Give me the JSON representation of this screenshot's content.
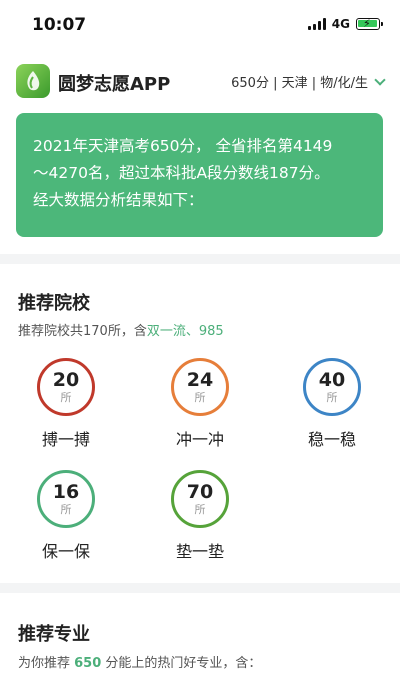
{
  "status": {
    "time": "10:07",
    "network": "4G"
  },
  "header": {
    "app_name": "圆梦志愿APP",
    "profile": "650分 | 天津 | 物/化/生"
  },
  "banner": {
    "line1": "2021年天津高考650分， 全省排名第4149",
    "line2": "～4270名，超过本科批A段分数线187分。",
    "line3": "经大数据分析结果如下："
  },
  "recommend_schools": {
    "title": "推荐院校",
    "subtitle_prefix": "推荐院校共170所，含",
    "subtitle_highlight": "双一流、985",
    "categories": [
      {
        "count": "20",
        "unit": "所",
        "label": "搏一搏",
        "color": "#c0392b"
      },
      {
        "count": "24",
        "unit": "所",
        "label": "冲一冲",
        "color": "#e67e3a"
      },
      {
        "count": "40",
        "unit": "所",
        "label": "稳一稳",
        "color": "#3d85c6"
      },
      {
        "count": "16",
        "unit": "所",
        "label": "保一保",
        "color": "#4caf7a"
      },
      {
        "count": "70",
        "unit": "所",
        "label": "垫一垫",
        "color": "#56a33a"
      }
    ]
  },
  "recommend_majors": {
    "title": "推荐专业",
    "subtitle_prefix": "为你推荐 ",
    "subtitle_score": "650",
    "subtitle_suffix": " 分能上的热门好专业，含："
  }
}
